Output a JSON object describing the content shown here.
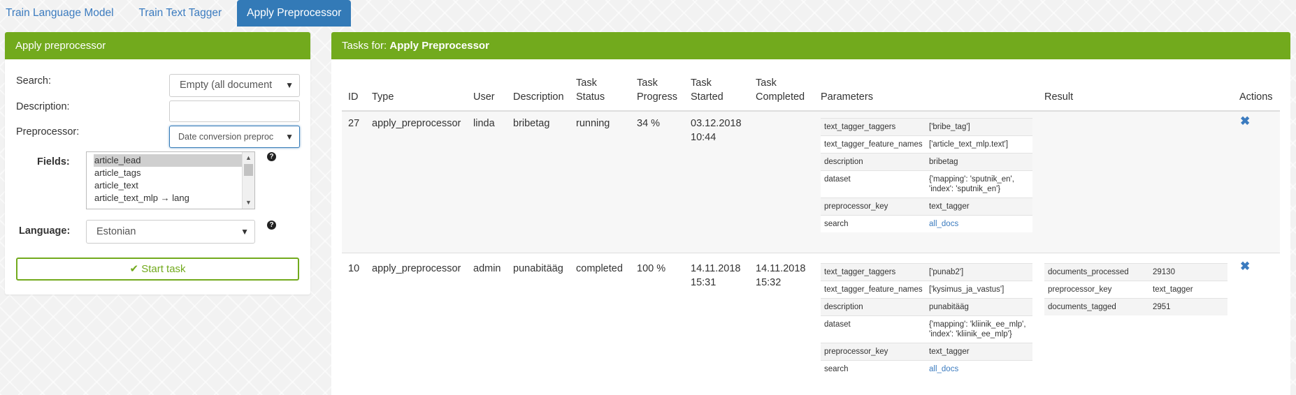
{
  "tabs": [
    {
      "label": "Train Language Model"
    },
    {
      "label": "Train Text Tagger"
    },
    {
      "label": "Apply Preprocessor"
    }
  ],
  "left_panel": {
    "title": "Apply preprocessor",
    "search_label": "Search:",
    "search_value": "Empty (all document",
    "description_label": "Description:",
    "description_value": "",
    "preprocessor_label": "Preprocessor:",
    "preprocessor_value": "Date conversion preproc",
    "fields_label": "Fields:",
    "fields_options": [
      "article_lead",
      "article_tags",
      "article_text",
      "article_text_mlp → lang"
    ],
    "fields_selected": "article_lead",
    "language_label": "Language:",
    "language_value": "Estonian",
    "start_button": "Start task",
    "help_glyph": "?"
  },
  "tasks_panel": {
    "title_prefix": "Tasks for: ",
    "title_bold": "Apply Preprocessor",
    "columns": {
      "id": "ID",
      "type": "Type",
      "user": "User",
      "description": "Description",
      "status1": "Task",
      "status2": "Status",
      "progress1": "Task",
      "progress2": "Progress",
      "started1": "Task",
      "started2": "Started",
      "completed1": "Task",
      "completed2": "Completed",
      "parameters": "Parameters",
      "result": "Result",
      "actions": "Actions"
    },
    "rows": [
      {
        "id": "27",
        "type": "apply_preprocessor",
        "user": "linda",
        "description": "bribetag",
        "status": "running",
        "progress": "34 %",
        "started_date": "03.12.2018",
        "started_time": "10:44",
        "completed_date": "",
        "completed_time": "",
        "parameters": [
          {
            "key": "text_tagger_taggers",
            "value": "['bribe_tag']"
          },
          {
            "key": "text_tagger_feature_names",
            "value": "['article_text_mlp.text']"
          },
          {
            "key": "description",
            "value": "bribetag"
          },
          {
            "key": "dataset",
            "value": "{'mapping': 'sputnik_en', 'index': 'sputnik_en'}"
          },
          {
            "key": "preprocessor_key",
            "value": "text_tagger"
          },
          {
            "key": "search",
            "value": "all_docs"
          }
        ],
        "result": []
      },
      {
        "id": "10",
        "type": "apply_preprocessor",
        "user": "admin",
        "description": "punabitääg",
        "status": "completed",
        "progress": "100 %",
        "started_date": "14.11.2018",
        "started_time": "15:31",
        "completed_date": "14.11.2018",
        "completed_time": "15:32",
        "parameters": [
          {
            "key": "text_tagger_taggers",
            "value": "['punab2']"
          },
          {
            "key": "text_tagger_feature_names",
            "value": "['kysimus_ja_vastus']"
          },
          {
            "key": "description",
            "value": "punabitääg"
          },
          {
            "key": "dataset",
            "value": "{'mapping': 'kliinik_ee_mlp', 'index': 'kliinik_ee_mlp'}"
          },
          {
            "key": "preprocessor_key",
            "value": "text_tagger"
          },
          {
            "key": "search",
            "value": "all_docs"
          }
        ],
        "result": [
          {
            "key": "documents_processed",
            "value": "29130"
          },
          {
            "key": "preprocessor_key",
            "value": "text_tagger"
          },
          {
            "key": "documents_tagged",
            "value": "2951"
          }
        ]
      }
    ]
  },
  "colors": {
    "header_green": "#72aa1d",
    "active_tab": "#337ab7",
    "link_blue": "#3b7bbf"
  },
  "icons": {
    "delete": "times-icon",
    "start": "check-icon",
    "help": "question-circle-icon",
    "dropdown": "caret-down-icon"
  }
}
